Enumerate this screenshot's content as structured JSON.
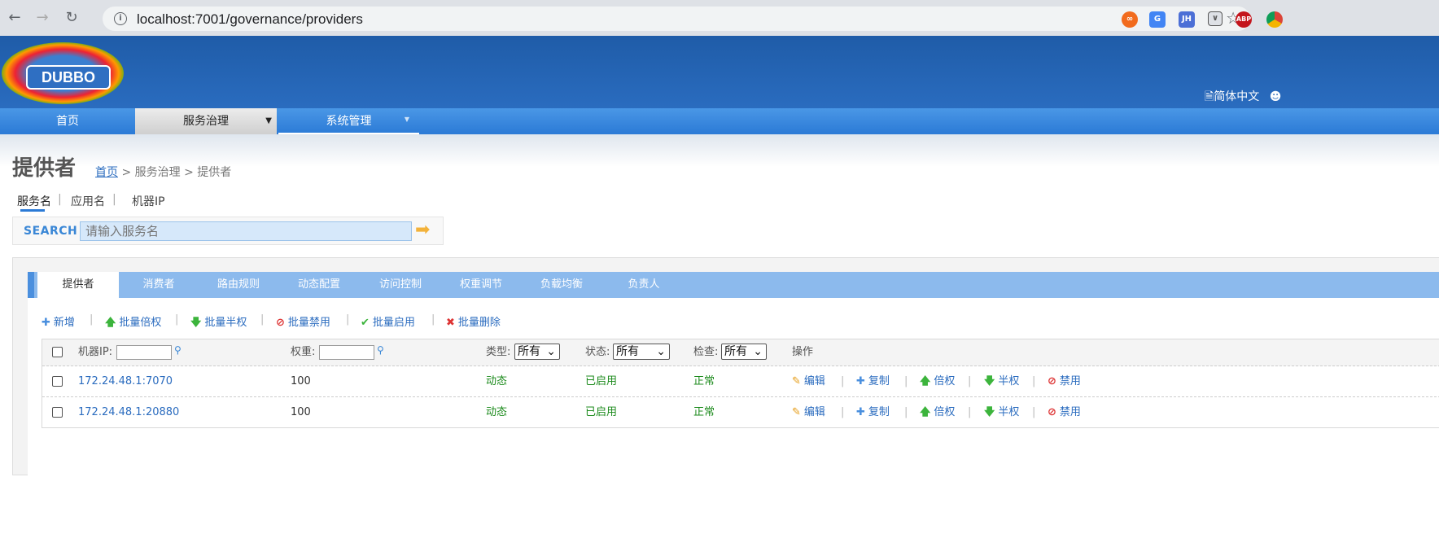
{
  "browser": {
    "url": "localhost:7001/governance/providers",
    "extensions": [
      "infinity-icon",
      "translate-icon",
      "jh-icon",
      "pocket-icon",
      "abp-icon",
      "chrome-icon"
    ],
    "ext_labels": {
      "jh": "JH",
      "abp": "ABP"
    }
  },
  "header": {
    "logo_text": "DUBBO",
    "language": "简体中文"
  },
  "main_nav": [
    {
      "label": "首页"
    },
    {
      "label": "服务治理",
      "active": true
    },
    {
      "label": "系统管理"
    }
  ],
  "page": {
    "title": "提供者",
    "breadcrumb": {
      "home": "首页",
      "rest": " > 服务治理 > 提供者"
    }
  },
  "search_tabs": [
    "服务名",
    "应用名",
    "机器IP"
  ],
  "search": {
    "label": "SEARCH",
    "placeholder": "请输入服务名"
  },
  "content_tabs": [
    "提供者",
    "消费者",
    "路由规则",
    "动态配置",
    "访问控制",
    "权重调节",
    "负载均衡",
    "负责人"
  ],
  "toolbar": [
    "新增",
    "批量倍权",
    "批量半权",
    "批量禁用",
    "批量启用",
    "批量删除"
  ],
  "table": {
    "headers": {
      "ip": "机器IP:",
      "weight": "权重:",
      "type": "类型:",
      "status": "状态:",
      "check": "检查:",
      "actions": "操作",
      "all_option": "所有"
    },
    "rows": [
      {
        "address": "172.24.48.1:7070",
        "weight": "100",
        "type": "动态",
        "status": "已启用",
        "check": "正常"
      },
      {
        "address": "172.24.48.1:20880",
        "weight": "100",
        "type": "动态",
        "status": "已启用",
        "check": "正常"
      }
    ],
    "row_actions": [
      "编辑",
      "复制",
      "倍权",
      "半权",
      "禁用"
    ]
  },
  "colors": {
    "brand_blue": "#1f5ca8",
    "nav_blue": "#2b7ad6",
    "tab_bar": "#8cbaed",
    "link": "#2b6cbf",
    "ok_green": "#1b8a1b"
  }
}
